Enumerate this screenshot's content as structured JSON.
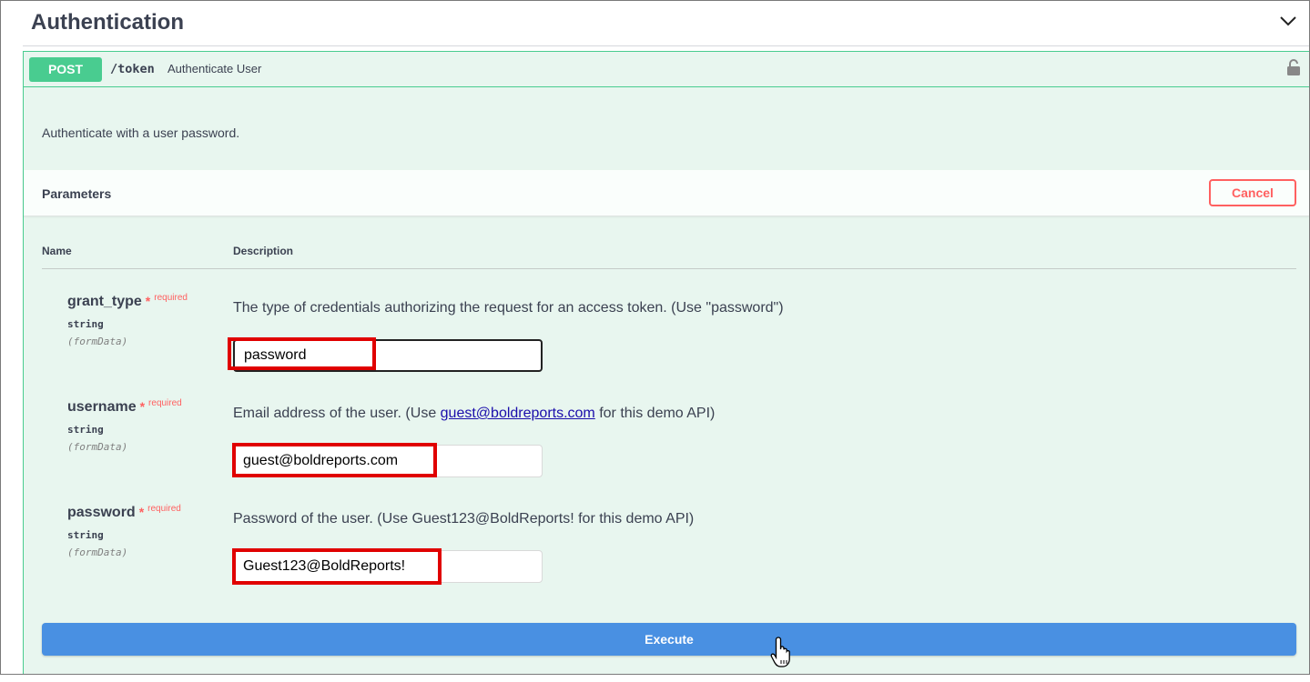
{
  "tag": {
    "title": "Authentication"
  },
  "operation": {
    "method": "POST",
    "path": "/token",
    "summary": "Authenticate User",
    "description": "Authenticate with a user password."
  },
  "parameters": {
    "title": "Parameters",
    "cancel_label": "Cancel",
    "col_name": "Name",
    "col_description": "Description",
    "required_star": "*",
    "required_label": "required",
    "items": [
      {
        "name": "grant_type",
        "type": "string",
        "in": "(formData)",
        "description": "The type of credentials authorizing the request for an access token. (Use \"password\")",
        "value": "password"
      },
      {
        "name": "username",
        "type": "string",
        "in": "(formData)",
        "description_prefix": "Email address of the user. (Use ",
        "description_link": "guest@boldreports.com",
        "description_suffix": " for this demo API)",
        "value": "guest@boldreports.com"
      },
      {
        "name": "password",
        "type": "string",
        "in": "(formData)",
        "description": "Password of the user. (Use Guest123@BoldReports! for this demo API)",
        "value": "Guest123@BoldReports!"
      }
    ]
  },
  "execute_label": "Execute",
  "icons": {
    "collapse": "chevron-down-icon",
    "lock": "lock-open-icon",
    "cursor": "hand-pointer-icon"
  },
  "colors": {
    "post": "#49cc90",
    "execute": "#4990e2",
    "cancel": "#ff6060",
    "highlight": "#e00000"
  }
}
